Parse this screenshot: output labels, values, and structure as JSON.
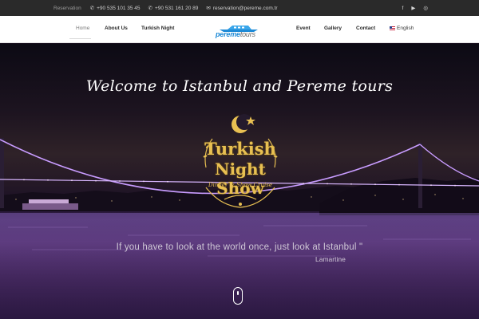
{
  "topbar": {
    "reservation_label": "Reservation",
    "phone1": "+90 535 101 35 45",
    "phone2": "+90 531 161 20 89",
    "email": "reservation@pereme.com.tr",
    "social": [
      "f",
      "▶",
      "◎"
    ]
  },
  "nav": {
    "left": [
      "Home",
      "About Us",
      "Turkish Night"
    ],
    "right": [
      "Event",
      "Gallery",
      "Contact"
    ],
    "language": "English",
    "active": "Home"
  },
  "logo": {
    "part1": "pereme",
    "part2": "tours"
  },
  "hero": {
    "welcome": "Welcome to Istanbul and Pereme tours",
    "emblem_line1": "Turkish",
    "emblem_line2": "Night Show",
    "emblem_line3": "Dinner & Show Cruise",
    "quote": "If you have to look at the world once, just look at Istanbul \"",
    "author": "Lamartine"
  },
  "colors": {
    "topbar_bg": "#2a2a2a",
    "nav_bg": "#ffffff",
    "accent_blue": "#1e8ad6",
    "gold": "#e8c052",
    "bridge_lights": "#c89cff"
  },
  "icons": {
    "phone": "phone-icon",
    "email": "envelope-icon",
    "facebook": "facebook-icon",
    "youtube": "youtube-icon",
    "instagram": "instagram-icon",
    "scroll": "mouse-scroll-icon"
  }
}
